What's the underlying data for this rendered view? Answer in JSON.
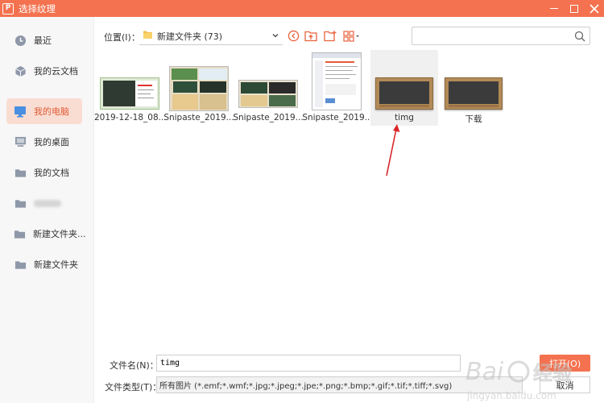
{
  "window": {
    "title": "选择纹理",
    "logo_char": "P"
  },
  "sidebar": {
    "items": [
      {
        "label": "最近",
        "icon": "clock-icon"
      },
      {
        "label": "我的云文档",
        "icon": "cloud-cube-icon"
      },
      {
        "label": "我的电脑",
        "icon": "monitor-icon",
        "active": true
      },
      {
        "label": "我的桌面",
        "icon": "desktop-icon"
      },
      {
        "label": "我的文档",
        "icon": "folder-icon"
      },
      {
        "label": "",
        "icon": "folder-icon",
        "blurred": true
      },
      {
        "label": "新建文件夹...",
        "icon": "folder-icon"
      },
      {
        "label": "新建文件夹",
        "icon": "folder-icon"
      }
    ]
  },
  "toolbar": {
    "location_label": "位置(I)：",
    "location_value": "新建文件夹 (73)",
    "search_placeholder": ""
  },
  "files": [
    {
      "name": "2019-12-18_08...",
      "thumb": "screenshot-red"
    },
    {
      "name": "Snipaste_2019...",
      "thumb": "collage-green"
    },
    {
      "name": "Snipaste_2019...",
      "thumb": "collage-dark"
    },
    {
      "name": "Snipaste_2019...",
      "thumb": "document"
    },
    {
      "name": "timg",
      "thumb": "chalkboard",
      "selected": true
    },
    {
      "name": "下载",
      "thumb": "chalkboard"
    }
  ],
  "footer": {
    "filename_label": "文件名(N)：",
    "filename_value": "timg",
    "filetype_label": "文件类型(T)：",
    "filetype_value": "所有图片 (*.emf;*.wmf;*.jpg;*.jpeg;*.jpe;*.png;*.bmp;*.gif;*.tif;*.tiff;*.svg)",
    "open_label": "打开(O)",
    "cancel_label": "取消"
  },
  "watermark": {
    "line1": "Bai",
    "line2": "经验",
    "url": "jingyan.baidu.com"
  },
  "colors": {
    "accent": "#f4724f",
    "active_bg": "#f9ddd2",
    "active_text": "#e15b38",
    "arrow": "#d8262a"
  }
}
